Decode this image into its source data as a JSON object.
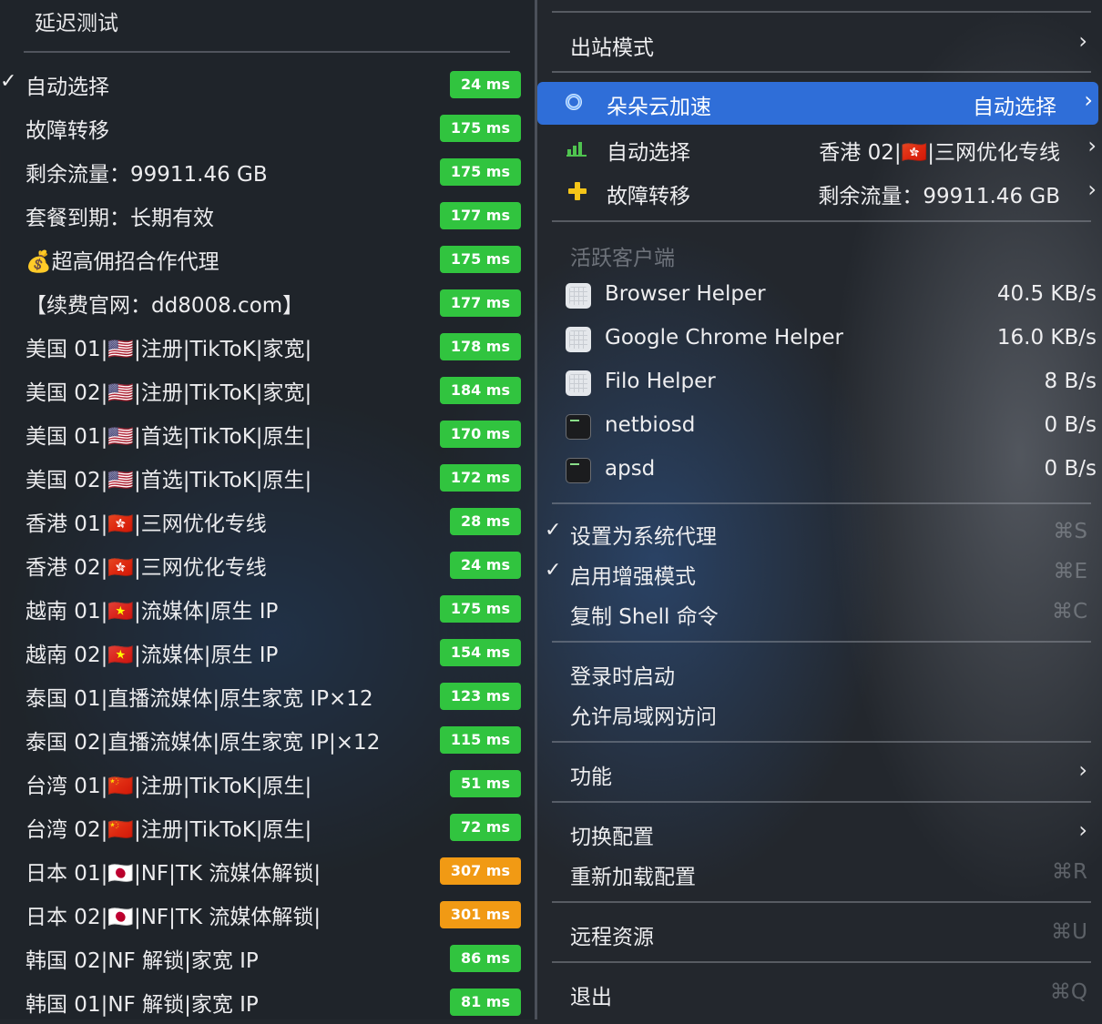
{
  "left_panel": {
    "title": "延迟测试",
    "items": [
      {
        "label": "自动选择",
        "latency": "24 ms",
        "color": "#31c43f",
        "checked": "✓"
      },
      {
        "label": "故障转移",
        "latency": "175 ms",
        "color": "#31c43f"
      },
      {
        "label": "剩余流量：99911.46 GB",
        "latency": "175 ms",
        "color": "#31c43f"
      },
      {
        "label": "套餐到期：长期有效",
        "latency": "177 ms",
        "color": "#31c43f"
      },
      {
        "label": "💰超高佣招合作代理",
        "latency": "175 ms",
        "color": "#31c43f"
      },
      {
        "label": "【续费官网：dd8008.com】",
        "latency": "177 ms",
        "color": "#31c43f"
      },
      {
        "label": "美国 01|🇺🇸|注册|TikToK|家宽|",
        "latency": "178 ms",
        "color": "#31c43f"
      },
      {
        "label": "美国 02|🇺🇸|注册|TikToK|家宽|",
        "latency": "184 ms",
        "color": "#31c43f"
      },
      {
        "label": "美国 01|🇺🇸|首选|TikToK|原生|",
        "latency": "170 ms",
        "color": "#31c43f"
      },
      {
        "label": "美国 02|🇺🇸|首选|TikToK|原生|",
        "latency": "172 ms",
        "color": "#31c43f"
      },
      {
        "label": "香港 01|🇭🇰|三网优化专线",
        "latency": "28 ms",
        "color": "#31c43f"
      },
      {
        "label": "香港 02|🇭🇰|三网优化专线",
        "latency": "24 ms",
        "color": "#31c43f"
      },
      {
        "label": "越南 01|🇻🇳|流媒体|原生 IP",
        "latency": "175 ms",
        "color": "#31c43f"
      },
      {
        "label": "越南 02|🇻🇳|流媒体|原生 IP",
        "latency": "154 ms",
        "color": "#31c43f"
      },
      {
        "label": "泰国 01|直播流媒体|原生家宽 IP×12",
        "latency": "123 ms",
        "color": "#31c43f"
      },
      {
        "label": "泰国 02|直播流媒体|原生家宽 IP|×12",
        "latency": "115 ms",
        "color": "#31c43f"
      },
      {
        "label": "台湾 01|🇨🇳|注册|TikToK|原生|",
        "latency": "51 ms",
        "color": "#31c43f"
      },
      {
        "label": "台湾 02|🇨🇳|注册|TikToK|原生|",
        "latency": "72 ms",
        "color": "#31c43f"
      },
      {
        "label": "日本 01|🇯🇵|NF|TK 流媒体解锁|",
        "latency": "307 ms",
        "color": "#f19a14"
      },
      {
        "label": "日本 02|🇯🇵|NF|TK 流媒体解锁|",
        "latency": "301 ms",
        "color": "#f19a14"
      },
      {
        "label": "韩国 02|NF 解锁|家宽 IP",
        "latency": "86 ms",
        "color": "#31c43f"
      },
      {
        "label": "韩国 01|NF 解锁|家宽 IP",
        "latency": "81 ms",
        "color": "#31c43f"
      }
    ]
  },
  "menu": {
    "outbound_mode": {
      "label": "出站模式",
      "chevron": "›"
    },
    "proxy_groups": [
      {
        "label": "朵朵云加速",
        "value": "自动选择",
        "icon": "ring-icon",
        "selected": true
      },
      {
        "label": "自动选择",
        "value": "香港 02|🇭🇰|三网优化专线",
        "icon": "bars-icon"
      },
      {
        "label": "故障转移",
        "value": "剩余流量：99911.46 GB",
        "icon": "plus-icon"
      }
    ],
    "active_clients_title": "活跃客户端",
    "clients": [
      {
        "name": "Browser Helper",
        "rate": "40.5 KB/s",
        "icon": "app-icon"
      },
      {
        "name": "Google Chrome Helper",
        "rate": "16.0 KB/s",
        "icon": "app-icon"
      },
      {
        "name": "Filo Helper",
        "rate": "8 B/s",
        "icon": "app-icon"
      },
      {
        "name": "netbiosd",
        "rate": "0 B/s",
        "icon": "terminal-icon"
      },
      {
        "name": "apsd",
        "rate": "0 B/s",
        "icon": "terminal-icon"
      }
    ],
    "set_system_proxy": {
      "label": "设置为系统代理",
      "shortcut": "⌘S",
      "check": "✓"
    },
    "enhanced_mode": {
      "label": "启用增强模式",
      "shortcut": "⌘E",
      "check": "✓"
    },
    "copy_shell": {
      "label": "复制 Shell 命令",
      "shortcut": "⌘C"
    },
    "launch_at_login": {
      "label": "登录时启动"
    },
    "allow_lan": {
      "label": "允许局域网访问"
    },
    "features": {
      "label": "功能",
      "chevron": "›"
    },
    "switch_config": {
      "label": "切换配置",
      "chevron": "›"
    },
    "reload_config": {
      "label": "重新加载配置",
      "shortcut": "⌘R"
    },
    "remote_resources": {
      "label": "远程资源",
      "shortcut": "⌘U"
    },
    "quit": {
      "label": "退出",
      "shortcut": "⌘Q"
    }
  }
}
